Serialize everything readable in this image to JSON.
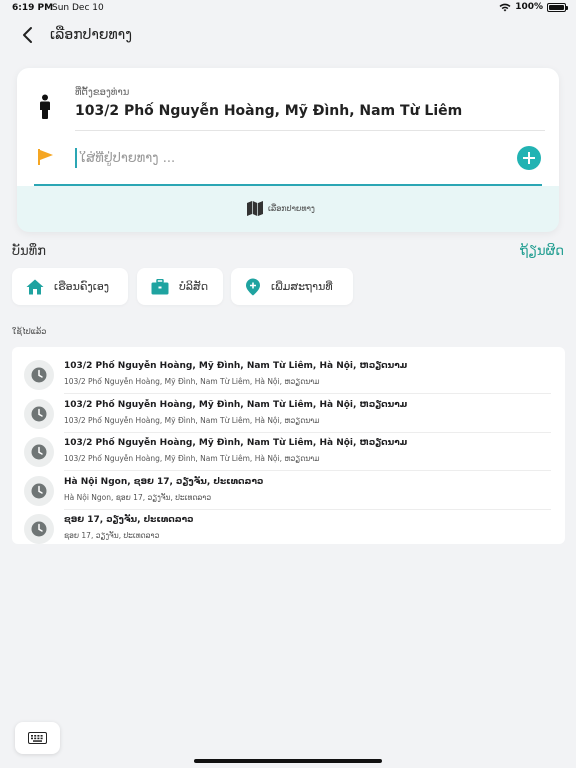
{
  "status_bar": {
    "time": "6:19 PM",
    "date": "Sun Dec 10",
    "battery": "100%"
  },
  "nav": {
    "title": "ເລືອກປາຍທາງ"
  },
  "route": {
    "origin_label": "ທີ່ຕັ້ງຂອງທ່ານ",
    "origin_address": "103/2 Phố Nguyễn Hoàng, Mỹ Đình, Nam Từ Liêm",
    "destination_placeholder": "ໃສ່ທີ່ຢູ່ປາຍທາງ ...",
    "destination_value": "",
    "map_button_label": "ເລືອກປາຍທາງ"
  },
  "saved": {
    "title": "ບັນທຶກ",
    "edit_label": "ຖ້ຽນຜິດ",
    "chips": [
      {
        "label": "ເຮືອນຄົງເອງ",
        "icon": "home-icon"
      },
      {
        "label": "ບໍລິສັດ",
        "icon": "briefcase-icon"
      },
      {
        "label": "ເພີ່ມສະຖານທີ່",
        "icon": "add-location-icon"
      }
    ]
  },
  "recent": {
    "title": "ໃຊ້ໄປແລ້ວ",
    "items": [
      {
        "title": "103/2 Phố Nguyễn Hoàng, Mỹ Đình, Nam Từ Liêm, Hà Nội, ຫວຽດນາມ",
        "subtitle": "103/2 Phố Nguyễn Hoàng, Mỹ Đình, Nam Từ Liêm, Hà Nội, ຫວຽດນາມ"
      },
      {
        "title": "103/2 Phố Nguyễn Hoàng, Mỹ Đình, Nam Từ Liêm, Hà Nội, ຫວຽດນາມ",
        "subtitle": "103/2 Phố Nguyễn Hoàng, Mỹ Đình, Nam Từ Liêm, Hà Nội, ຫວຽດນາມ"
      },
      {
        "title": "103/2 Phố Nguyễn Hoàng, Mỹ Đình, Nam Từ Liêm, Hà Nội, ຫວຽດນາມ",
        "subtitle": "103/2 Phố Nguyễn Hoàng, Mỹ Đình, Nam Từ Liêm, Hà Nội, ຫວຽດນາມ"
      },
      {
        "title": "Hà Nội Ngon, ຊອຍ 17, ວຽງຈັນ, ປະເທດລາວ",
        "subtitle": "Hà Nội Ngon, ຊອຍ 17, ວຽງຈັນ, ປະເທດລາວ"
      },
      {
        "title": "ຊອຍ 17, ວຽງຈັນ, ປະເທດລາວ",
        "subtitle": "ຊອຍ 17, ວຽງຈັນ, ປະເທດລາວ"
      }
    ]
  },
  "colors": {
    "accent": "#22b3b3",
    "accent_text": "#1e9c8f",
    "flag": "#f5a623",
    "background": "#f2f3f5"
  }
}
